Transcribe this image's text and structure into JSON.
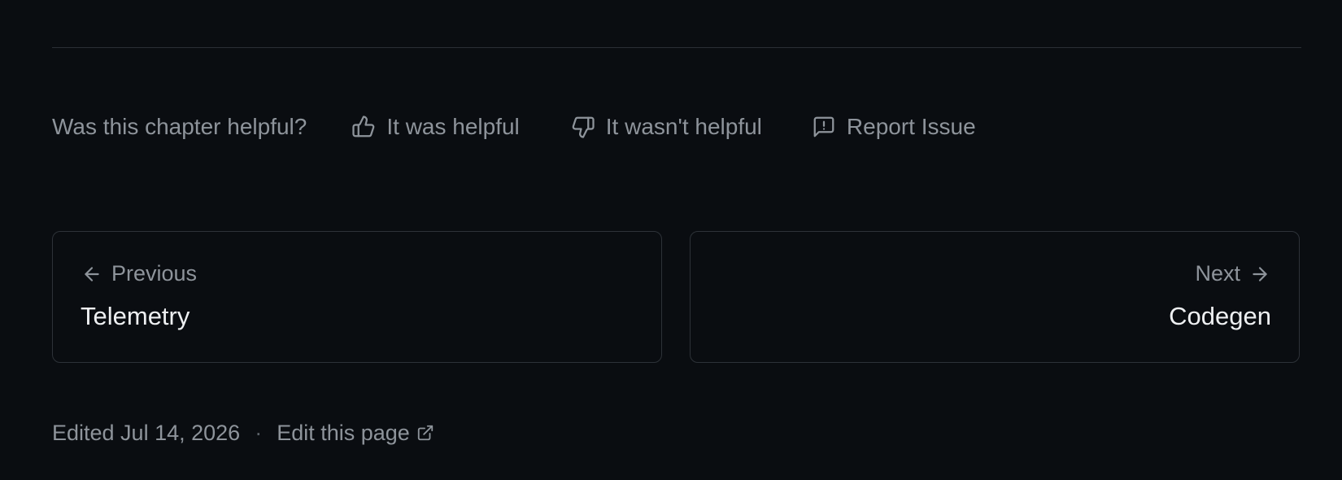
{
  "feedback": {
    "question": "Was this chapter helpful?",
    "helpful_label": "It was helpful",
    "not_helpful_label": "It wasn't helpful",
    "report_label": "Report Issue",
    "icons": {
      "helpful": "thumbs-up-icon",
      "not_helpful": "thumbs-down-icon",
      "report": "message-alert-icon"
    }
  },
  "pagination": {
    "previous": {
      "direction_label": "Previous",
      "title": "Telemetry",
      "icon": "arrow-left-icon"
    },
    "next": {
      "direction_label": "Next",
      "title": "Codegen",
      "icon": "arrow-right-icon"
    }
  },
  "footer": {
    "edited_text": "Edited Jul 14, 2026",
    "separator": "·",
    "edit_link_label": "Edit this page",
    "edit_link_icon": "external-link-icon"
  },
  "colors": {
    "background": "#0a0d11",
    "muted_text": "#8e949b",
    "title_text": "#eef0f2",
    "border": "#2d3238"
  }
}
